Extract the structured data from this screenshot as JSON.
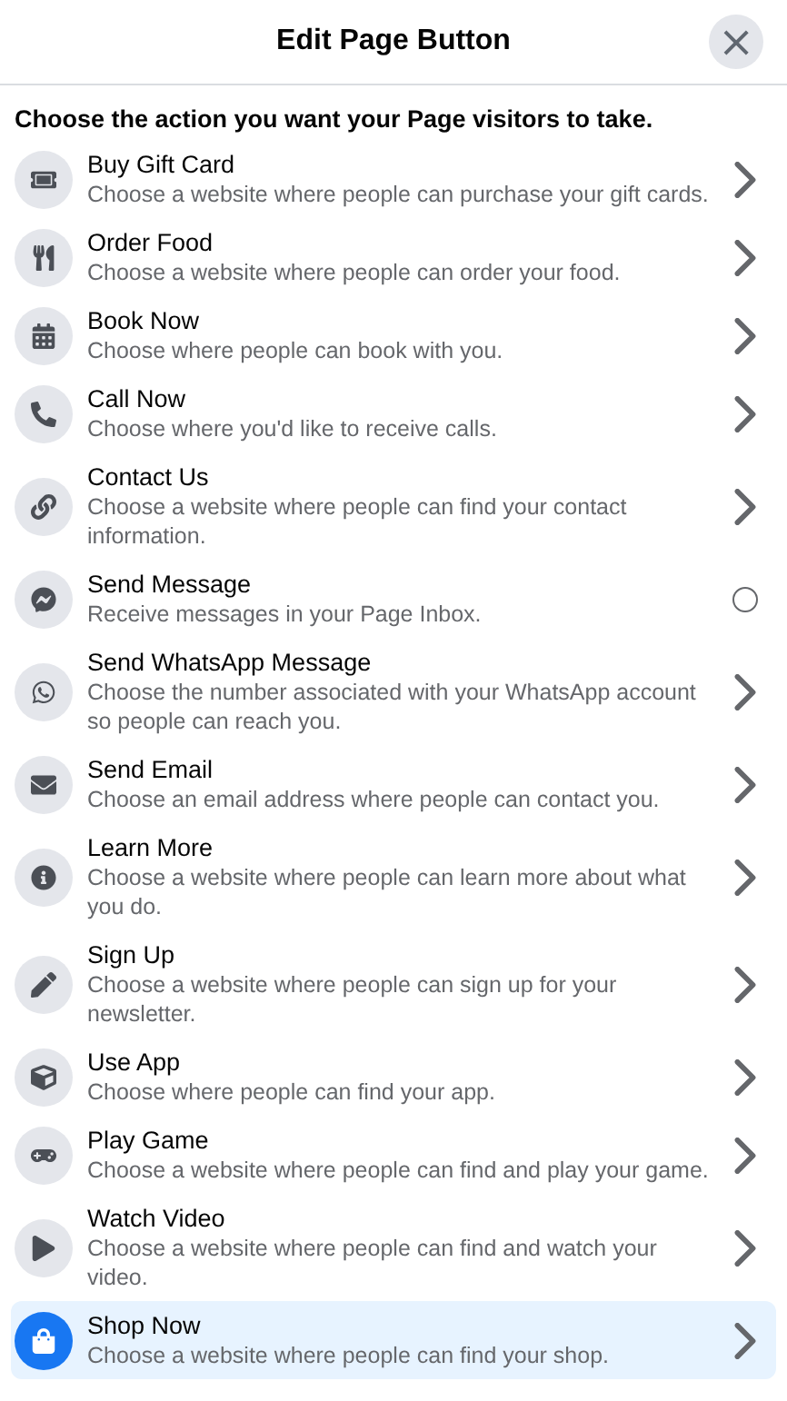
{
  "dialog": {
    "title": "Edit Page Button",
    "close_label": "×"
  },
  "prompt": "Choose the action you want your Page visitors to take.",
  "actions": [
    {
      "title": "Buy Gift Card",
      "description": "Choose a website where people can purchase your gift cards.",
      "kind": "chevron",
      "selected": false
    },
    {
      "title": "Order Food",
      "description": "Choose a website where people can order your food.",
      "kind": "chevron",
      "selected": false
    },
    {
      "title": "Book Now",
      "description": "Choose where people can book with you.",
      "kind": "chevron",
      "selected": false
    },
    {
      "title": "Call Now",
      "description": "Choose where you'd like to receive calls.",
      "kind": "chevron",
      "selected": false
    },
    {
      "title": "Contact Us",
      "description": "Choose a website where people can find your contact information.",
      "kind": "chevron",
      "selected": false
    },
    {
      "title": "Send Message",
      "description": "Receive messages in your Page Inbox.",
      "kind": "radio",
      "selected": false
    },
    {
      "title": "Send WhatsApp Message",
      "description": "Choose the number associated with your WhatsApp account so people can reach you.",
      "kind": "chevron",
      "selected": false
    },
    {
      "title": "Send Email",
      "description": "Choose an email address where people can contact you.",
      "kind": "chevron",
      "selected": false
    },
    {
      "title": "Learn More",
      "description": "Choose a website where people can learn more about what you do.",
      "kind": "chevron",
      "selected": false
    },
    {
      "title": "Sign Up",
      "description": "Choose a website where people can sign up for your newsletter.",
      "kind": "chevron",
      "selected": false
    },
    {
      "title": "Use App",
      "description": "Choose where people can find your app.",
      "kind": "chevron",
      "selected": false
    },
    {
      "title": "Play Game",
      "description": "Choose a website where people can find and play your game.",
      "kind": "chevron",
      "selected": false
    },
    {
      "title": "Watch Video",
      "description": "Choose a website where people can find and watch your video.",
      "kind": "chevron",
      "selected": false
    },
    {
      "title": "Shop Now",
      "description": "Choose a website where people can find your shop.",
      "kind": "chevron",
      "selected": true
    }
  ]
}
